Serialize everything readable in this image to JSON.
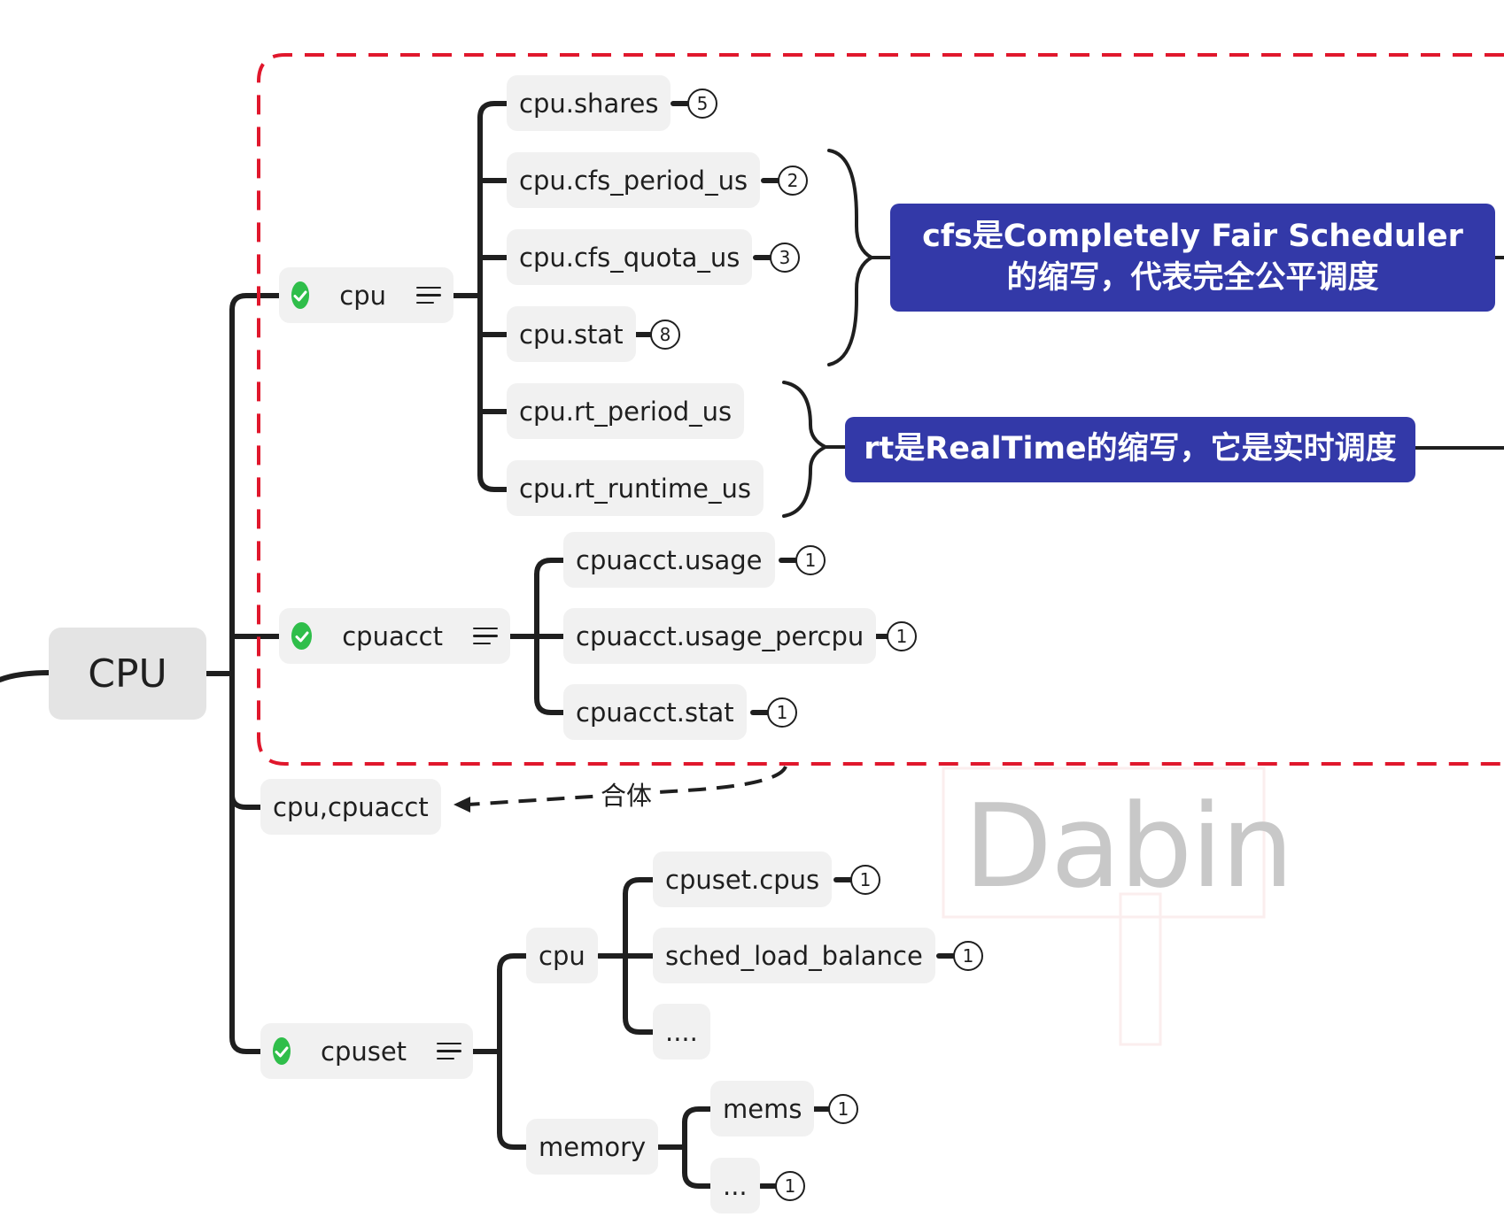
{
  "root": {
    "label": "CPU"
  },
  "subsystems": {
    "cpu": {
      "label": "cpu",
      "items": [
        {
          "label": "cpu.shares",
          "badge": "5"
        },
        {
          "label": "cpu.cfs_period_us",
          "badge": "2"
        },
        {
          "label": "cpu.cfs_quota_us",
          "badge": "3"
        },
        {
          "label": "cpu.stat",
          "badge": "8"
        },
        {
          "label": "cpu.rt_period_us"
        },
        {
          "label": "cpu.rt_runtime_us"
        }
      ]
    },
    "cpuacct": {
      "label": "cpuacct",
      "items": [
        {
          "label": "cpuacct.usage",
          "badge": "1"
        },
        {
          "label": "cpuacct.usage_percpu",
          "badge": "1"
        },
        {
          "label": "cpuacct.stat",
          "badge": "1"
        }
      ]
    },
    "combined": {
      "label": "cpu,cpuacct",
      "arrow_label": "合体"
    },
    "cpuset": {
      "label": "cpuset",
      "cpu_group": {
        "label": "cpu",
        "items": [
          {
            "label": "cpuset.cpus",
            "badge": "1"
          },
          {
            "label": "sched_load_balance",
            "badge": "1"
          },
          {
            "label": "...."
          }
        ]
      },
      "memory_group": {
        "label": "memory",
        "items": [
          {
            "label": "mems",
            "badge": "1"
          },
          {
            "label": "...",
            "badge": "1"
          }
        ]
      }
    }
  },
  "notes": {
    "cfs": "cfs是Completely Fair Scheduler的缩写，代表完全公平调度",
    "rt": "rt是RealTime的缩写，它是实时调度"
  },
  "watermark": "Dabin",
  "colors": {
    "note_bg": "#3339a8",
    "node_bg": "#f1f1f1",
    "check_green": "#2fbe4a",
    "dashed_frame": "#e0172c",
    "line": "#1f1f1f"
  }
}
